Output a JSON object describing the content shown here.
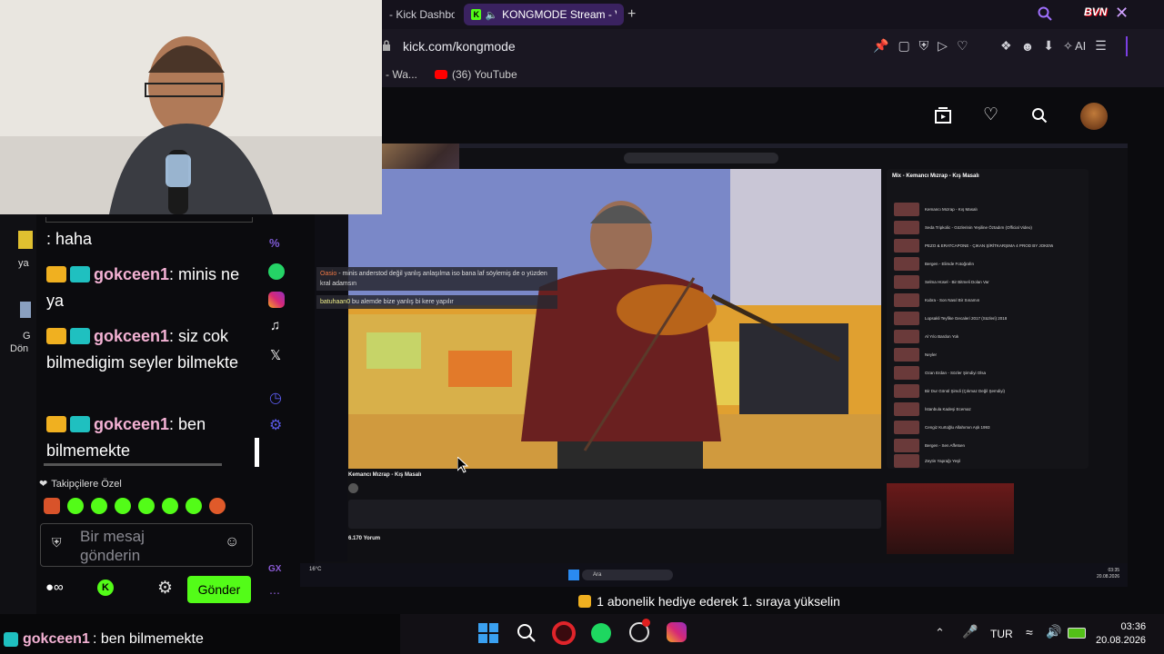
{
  "browser": {
    "tabs": [
      {
        "label": "- Kick Dashbo"
      },
      {
        "label": "KONGMODE Stream - V"
      }
    ],
    "url": "kick.com/kongmode",
    "bookmarks": [
      {
        "label": "- Wa..."
      },
      {
        "label": "(36) YouTube"
      }
    ],
    "ai_label": "AI",
    "overlay_text": "BVN"
  },
  "stream": {
    "chat_overlay": [
      {
        "user": "Oasio",
        "text": "minis anderstod değil yanlış anlaşılma iso bana laf söylemiş de o yüzden kral adamsın"
      },
      {
        "user": "batuhaan0",
        "text": "bu alemde bize yanlış bi kere yapılır"
      }
    ],
    "yt_title": "Kemancı Mızrap - Kış Masalı",
    "yt_comments": "6.170 Yorum",
    "yt_panel_title": "Mix - Kemancı Mızrap - Kış Masalı",
    "yt_items": [
      "Kemancı Mızrap - Kış Masalı",
      "Seda Tripkolic - Gözlerinin Yeşiline Öztadım (Official Video)",
      "PEZO & ERATCAPONE - ÇIKAN ŞİRİTKARŞIMA 4 PROD BY JOKEW",
      "Bergen - Elimde Fotoğrafın",
      "Selma Hüsel - Bir Bitmeli Dolan Var",
      "Kubra - Son Nasıl Bir Sınamın",
      "Lopsakli Teyfike Gecaleri 2017 (Süzleri) 2018",
      "Al Yılo Bardon Yok",
      "Neyler",
      "Ozan Erdan - Sözler Şimdiyi Olsa",
      "Bir Dur Gönül Şimdi (Çıkmaz Değil Şemdiyi)",
      "İstanbula Kadeşi Ecemaz",
      "Cengiz Kurtoğlu Allahımın Aşk 1993",
      "Bergen - Sen Affetsen",
      "Zeytin Yaprağı Yeşil"
    ],
    "inner_taskbar_weather": "16°C",
    "inner_taskbar_search": "Ara",
    "inner_clock_time": "03:35",
    "inner_clock_date": "20.08.2026"
  },
  "chat": {
    "messages": [
      {
        "user": "",
        "text": ": haha"
      },
      {
        "user": "gokceen1",
        "text": ": minis ne ya"
      },
      {
        "user": "gokceen1",
        "text": ": siz cok bilmedigim seyler bilmekte"
      },
      {
        "user": "gokceen1",
        "text": ": ben bilmemekte"
      }
    ],
    "followers_only": "Takipçilere Özel",
    "input_placeholder": "Bir mesaj gönderin",
    "send_label": "Gönder",
    "gx_label": "GX"
  },
  "notification": "1 abonelik hediye ederek 1. sıraya yükselin",
  "bottom_chat": {
    "user": "gokceen1",
    "text": ": ben bilmemekte"
  },
  "desktop": {
    "icon_labels": [
      "ya",
      "G",
      "Dön"
    ]
  },
  "taskbar": {
    "language": "TUR",
    "time": "03:36",
    "date": "20.08.2026"
  },
  "colors": {
    "kick_green": "#53fc18",
    "username_pink": "#f4b2d4",
    "browser_accent": "#7b3fe4"
  }
}
